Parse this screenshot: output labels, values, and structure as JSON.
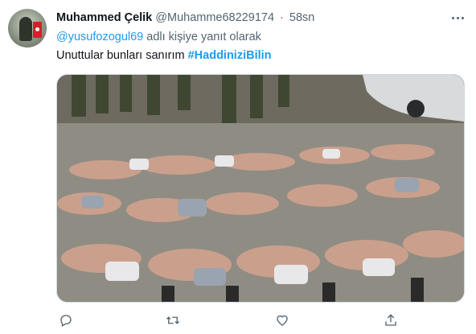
{
  "tweet": {
    "author_name": "Muhammed Çelik",
    "author_handle": "@Muhamme68229174",
    "separator": "·",
    "time": "58sn",
    "reply_to_handle": "@yusufozogul69",
    "reply_suffix": "adlı kişiye yanıt olarak",
    "text": "Unuttular bunları sanırım",
    "hashtag": "#HaddiniziBilin"
  },
  "icons": {
    "avatar": "avatar-image",
    "more": "more-icon",
    "reply": "reply-icon",
    "retweet": "retweet-icon",
    "like": "like-icon",
    "share": "share-icon"
  },
  "colors": {
    "link": "#1d9bf0",
    "muted": "#536471",
    "text": "#0f1419"
  }
}
